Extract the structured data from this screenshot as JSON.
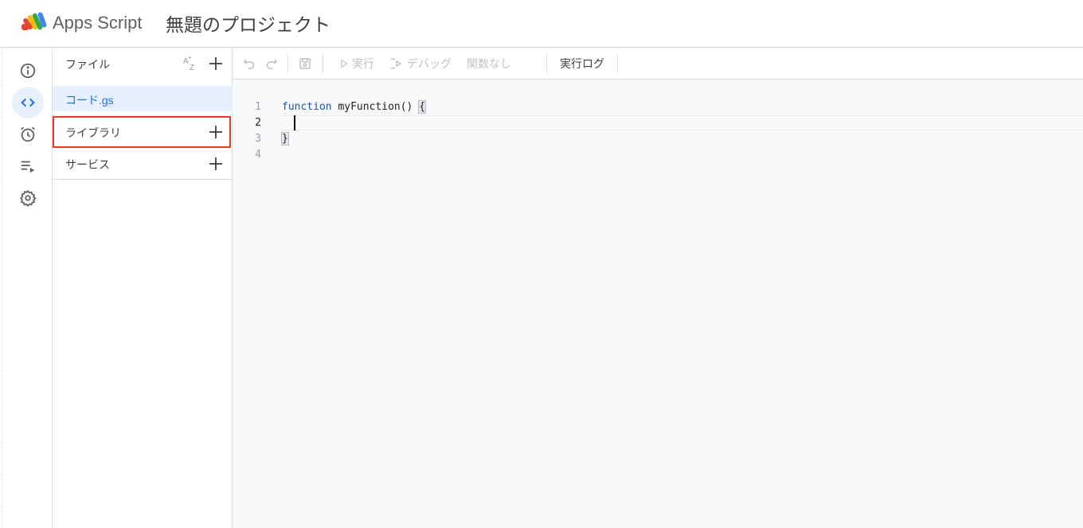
{
  "header": {
    "app_name": "Apps Script",
    "project_title": "無題のプロジェクト",
    "logo_icon": "apps-script-logo"
  },
  "rail": {
    "items": [
      {
        "name": "overview",
        "icon": "info-icon",
        "active": false
      },
      {
        "name": "editor",
        "icon": "code-icon",
        "active": true
      },
      {
        "name": "triggers",
        "icon": "alarm-icon",
        "active": false
      },
      {
        "name": "executions",
        "icon": "executions-icon",
        "active": false
      },
      {
        "name": "settings",
        "icon": "gear-icon",
        "active": false
      }
    ]
  },
  "files": {
    "title": "ファイル",
    "sort_icon": "sort-az-icon",
    "items": [
      {
        "label": "コード.gs",
        "selected": true
      }
    ],
    "libraries_label": "ライブラリ",
    "services_label": "サービス",
    "highlight_color": "#e53923"
  },
  "toolbar": {
    "undo_icon": "undo-icon",
    "redo_icon": "redo-icon",
    "save_icon": "save-icon",
    "run_label": "実行",
    "debug_label": "デバッグ",
    "function_select": "関数なし",
    "log_label": "実行ログ"
  },
  "editor": {
    "line_numbers": [
      "1",
      "2",
      "3",
      "4"
    ],
    "lines": {
      "l1_keyword": "function",
      "l1_rest": " myFunction() ",
      "l1_brace": "{",
      "l3_brace": "}"
    },
    "current_line": "2"
  }
}
